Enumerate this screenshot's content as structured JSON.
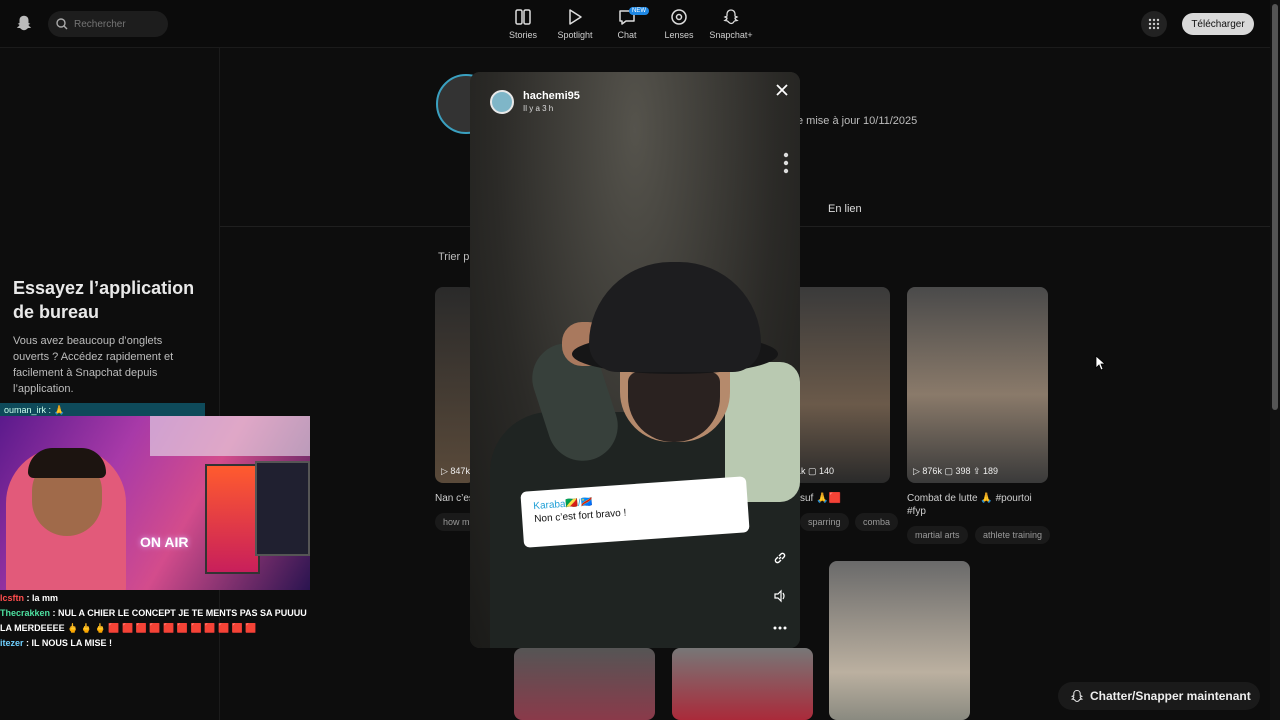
{
  "header": {
    "search_placeholder": "Rechercher",
    "nav": [
      {
        "label": "Stories",
        "icon": "stories-icon"
      },
      {
        "label": "Spotlight",
        "icon": "play-icon"
      },
      {
        "label": "Chat",
        "icon": "chat-icon",
        "badge": "NEW"
      },
      {
        "label": "Lenses",
        "icon": "lenses-icon"
      },
      {
        "label": "Snapchat+",
        "icon": "snapchat-plus-icon"
      }
    ],
    "download_label": "Télécharger"
  },
  "promo": {
    "title": "Essayez l’application de bureau",
    "text": "Vous avez beaucoup d’onglets ouverts ? Accédez rapidement et facilement à Snapchat depuis l’application."
  },
  "stream": {
    "top_line": "ouman_irk : 🙏",
    "overlay_text": "ON AIR",
    "chat": [
      {
        "user": "lcsftn",
        "text": " : la mm"
      },
      {
        "user": "Thecrakken",
        "text": " : NUL A CHIER LE CONCEPT JE TE MENTS PAS SA PUUUU LA MERDEEEE 🖕 🖕 🖕 🟥 🟥 🟥 🟥 🟥 🟥 🟥 🟥 🟥 🟥 🟥"
      },
      {
        "user": "itezer",
        "text": " : IL NOUS LA MISE !"
      }
    ]
  },
  "profile": {
    "updated": "e mise à jour 10/11/2025",
    "tab": "En lien",
    "sort": "Trier p"
  },
  "cards": [
    {
      "stats": "▷ 847k",
      "caption": "Nan c’es",
      "tags": [
        "how m"
      ]
    },
    {
      "stats": "1k  ▢ 140",
      "caption": "suf 🙏🟥",
      "tags": [
        "sparring",
        "comba"
      ]
    },
    {
      "stats": "▷ 876k  ▢ 398  ⇪ 189",
      "caption": "Combat de lutte 🙏 #pourtoi #fyp",
      "tags": [
        "martial arts",
        "athlete training"
      ]
    }
  ],
  "modal": {
    "username": "hachemi95",
    "time": "Il y a 3 h",
    "reply_name": "Karaba🇨🇬/🇨🇩",
    "reply_text": "Non c’est fort bravo !"
  },
  "chat_now": "Chatter/Snapper maintenant"
}
